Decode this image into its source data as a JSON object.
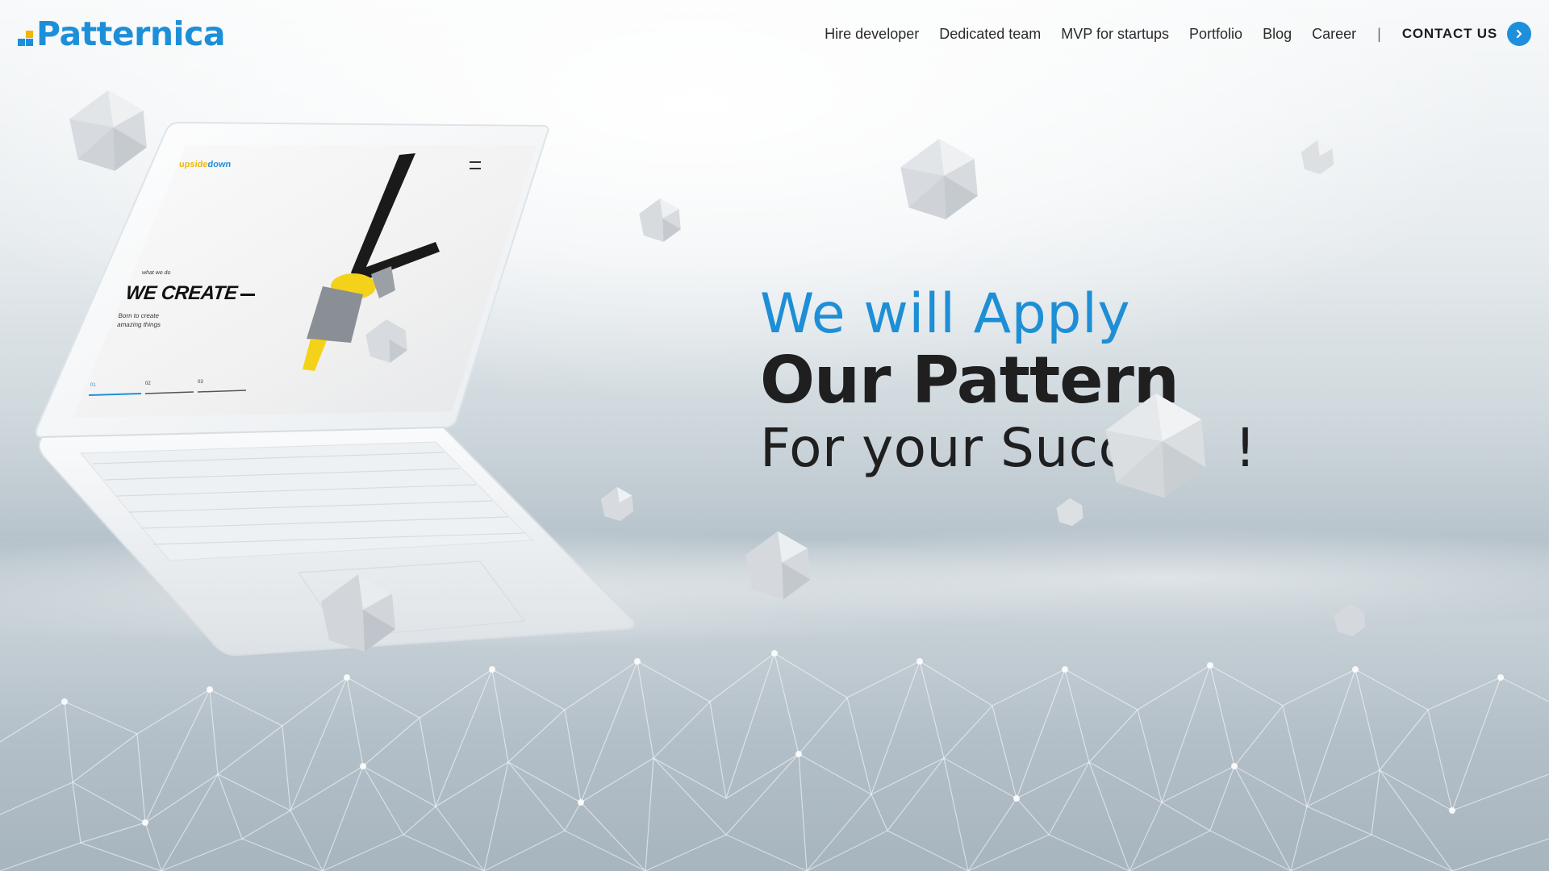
{
  "brand": {
    "name": "Patternica",
    "color": "#1d8fd8"
  },
  "nav": {
    "links": [
      "Hire developer",
      "Dedicated team",
      "MVP for startups",
      "Portfolio",
      "Blog",
      "Career"
    ],
    "separator": "|",
    "contact_label": "CONTACT US",
    "contact_icon": "chevron-right-icon"
  },
  "hero": {
    "line1": "We will Apply",
    "line2": "Our Pattern",
    "line3": "For your Succ",
    "line3_end": "!"
  },
  "laptop_screen": {
    "logo_part1": "upside",
    "logo_part2": "down",
    "eyebrow": "what we do",
    "headline": "WE CREATE",
    "sub": "Born to create amazing things",
    "pagination": [
      "01",
      "02",
      "03"
    ]
  },
  "colors": {
    "accent": "#1e8fdb",
    "heading_dark": "#1f1f1f"
  }
}
